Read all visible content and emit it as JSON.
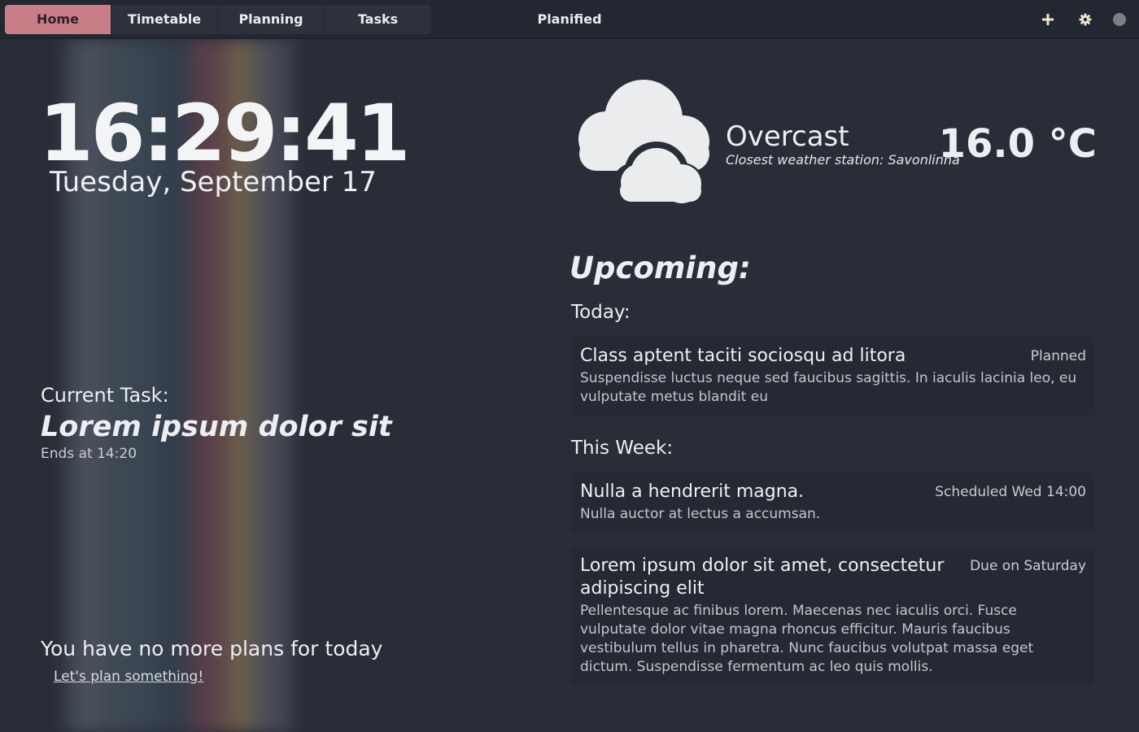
{
  "header": {
    "tabs": [
      {
        "label": "Home",
        "active": true
      },
      {
        "label": "Timetable",
        "active": false
      },
      {
        "label": "Planning",
        "active": false
      },
      {
        "label": "Tasks",
        "active": false
      }
    ],
    "title": "Planified",
    "icons": [
      "plus-icon",
      "gear-icon",
      "circle-icon"
    ]
  },
  "clock": {
    "time": "16:29:41",
    "date": "Tuesday, September 17"
  },
  "current_task": {
    "label": "Current Task:",
    "title": "Lorem ipsum dolor sit",
    "ends": "Ends at 14:20"
  },
  "plans": {
    "message": "You have no more plans for today",
    "link": "Let's plan something!"
  },
  "weather": {
    "icon": "overcast-cloud-icon",
    "condition": "Overcast",
    "station": "Closest weather station: Savonlinna",
    "temperature": "16.0 °C"
  },
  "upcoming": {
    "title": "Upcoming:",
    "today_label": "Today:",
    "today": [
      {
        "title": "Class aptent taciti sociosqu ad litora",
        "status": "Planned",
        "description": "Suspendisse luctus neque sed faucibus sagittis. In iaculis lacinia leo, eu vulputate metus blandit eu"
      }
    ],
    "week_label": "This Week:",
    "week": [
      {
        "title": "Nulla a hendrerit magna.",
        "status": "Scheduled Wed 14:00",
        "description": "Nulla auctor at lectus a accumsan."
      },
      {
        "title": "Lorem ipsum dolor sit amet, consectetur adipiscing elit",
        "status": "Due on Saturday",
        "description": "Pellentesque ac finibus lorem. Maecenas nec iaculis orci. Fusce vulputate dolor vitae magna rhoncus efficitur. Mauris faucibus vestibulum tellus in pharetra. Nunc faucibus volutpat massa eget dictum. Suspendisse fermentum ac leo quis mollis."
      }
    ]
  },
  "colors": {
    "background": "#282d38",
    "header": "#222731",
    "accent": "#c97d87",
    "card": "#242933"
  }
}
